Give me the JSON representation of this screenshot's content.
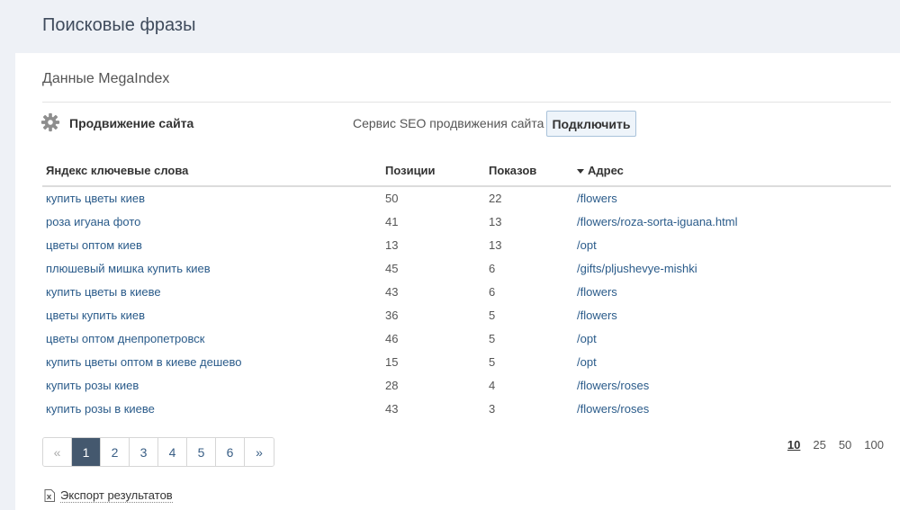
{
  "header": {
    "title": "Поисковые фразы"
  },
  "panel": {
    "title": "Данные MegaIndex",
    "promo": {
      "label": "Продвижение сайта",
      "description": "Сервис SEO продвижения сайта",
      "button_label": "Подключить"
    }
  },
  "table": {
    "columns": {
      "keywords": "Яндекс ключевые слова",
      "positions": "Позиции",
      "shows": "Показов",
      "address": "Адрес"
    },
    "rows": [
      {
        "keyword": "купить цветы киев",
        "position": "50",
        "shows": "22",
        "url": "/flowers"
      },
      {
        "keyword": "роза игуана фото",
        "position": "41",
        "shows": "13",
        "url": "/flowers/roza-sorta-iguana.html"
      },
      {
        "keyword": "цветы оптом киев",
        "position": "13",
        "shows": "13",
        "url": "/opt"
      },
      {
        "keyword": "плюшевый мишка купить киев",
        "position": "45",
        "shows": "6",
        "url": "/gifts/pljushevye-mishki"
      },
      {
        "keyword": "купить цветы в киеве",
        "position": "43",
        "shows": "6",
        "url": "/flowers"
      },
      {
        "keyword": "цветы купить киев",
        "position": "36",
        "shows": "5",
        "url": "/flowers"
      },
      {
        "keyword": "цветы оптом днепропетровск",
        "position": "46",
        "shows": "5",
        "url": "/opt"
      },
      {
        "keyword": "купить цветы оптом в киеве дешево",
        "position": "15",
        "shows": "5",
        "url": "/opt"
      },
      {
        "keyword": "купить розы киев",
        "position": "28",
        "shows": "4",
        "url": "/flowers/roses"
      },
      {
        "keyword": "купить розы в киеве",
        "position": "43",
        "shows": "3",
        "url": "/flowers/roses"
      }
    ]
  },
  "pagination": {
    "prev": "«",
    "pages": [
      "1",
      "2",
      "3",
      "4",
      "5",
      "6"
    ],
    "active_page": "1",
    "next": "»"
  },
  "per_page": {
    "options": [
      "10",
      "25",
      "50",
      "100"
    ],
    "selected": "10"
  },
  "export": {
    "label": "Экспорт результатов"
  }
}
